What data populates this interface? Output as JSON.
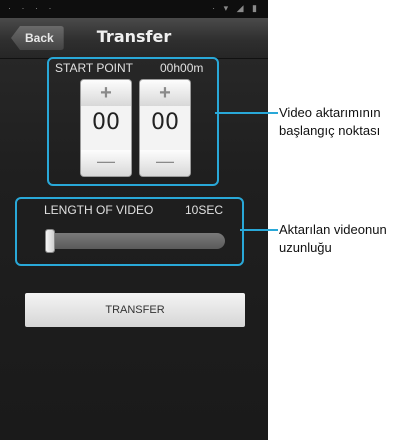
{
  "statusbar": {
    "left": "· · · ·",
    "right": "· ▾ ◢ ▮"
  },
  "navbar": {
    "back_label": "Back",
    "title": "Transfer"
  },
  "start_point": {
    "label": "START POINT",
    "value": "00h00m",
    "hours": {
      "plus": "+",
      "value": "00",
      "minus": "—"
    },
    "minutes": {
      "plus": "+",
      "value": "00",
      "minus": "—"
    }
  },
  "length": {
    "label": "LENGTH OF VIDEO",
    "value": "10SEC",
    "slider_fraction": 0.0
  },
  "transfer_button": {
    "label": "TRANSFER"
  },
  "annotations": {
    "start_point": [
      "Video aktarımının",
      "başlangıç noktası"
    ],
    "length": [
      "Aktarılan videonun",
      "uzunluğu"
    ]
  },
  "colors": {
    "callout": "#29a8d8"
  }
}
